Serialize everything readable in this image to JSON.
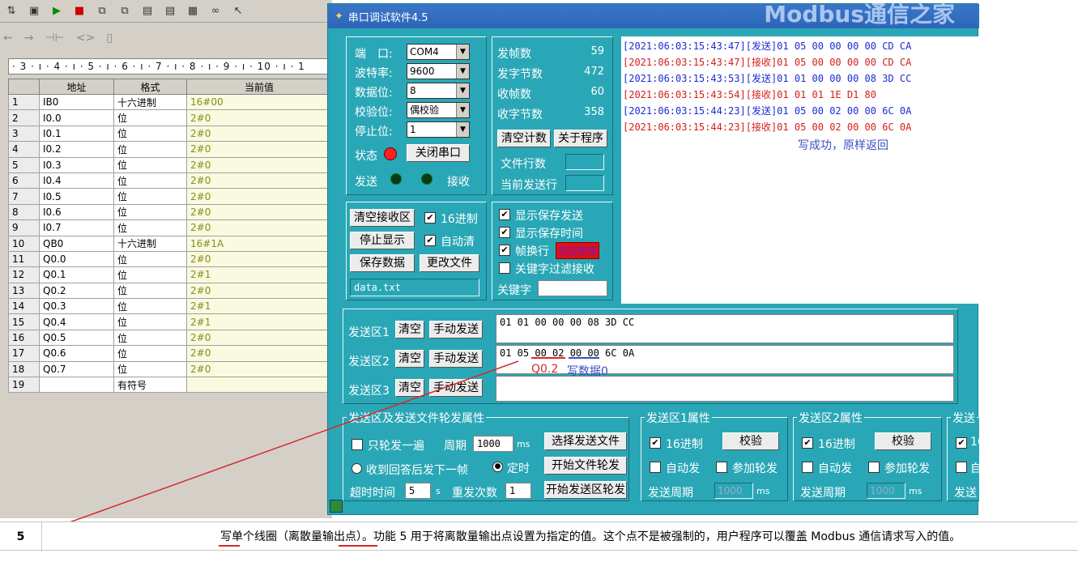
{
  "left_window": {
    "ruler": "· 3 · ı · 4 · ı · 5 · ı · 6 · ı · 7 · ı · 8 · ı · 9 · ı · 10 · ı · 1",
    "columns": [
      "地址",
      "格式",
      "当前值"
    ],
    "rows": [
      {
        "num": "1",
        "addr": "IB0",
        "fmt": "十六进制",
        "val": "16#00"
      },
      {
        "num": "2",
        "addr": "I0.0",
        "fmt": "位",
        "val": "2#0"
      },
      {
        "num": "3",
        "addr": "I0.1",
        "fmt": "位",
        "val": "2#0"
      },
      {
        "num": "4",
        "addr": "I0.2",
        "fmt": "位",
        "val": "2#0"
      },
      {
        "num": "5",
        "addr": "I0.3",
        "fmt": "位",
        "val": "2#0"
      },
      {
        "num": "6",
        "addr": "I0.4",
        "fmt": "位",
        "val": "2#0"
      },
      {
        "num": "7",
        "addr": "I0.5",
        "fmt": "位",
        "val": "2#0"
      },
      {
        "num": "8",
        "addr": "I0.6",
        "fmt": "位",
        "val": "2#0"
      },
      {
        "num": "9",
        "addr": "I0.7",
        "fmt": "位",
        "val": "2#0"
      },
      {
        "num": "10",
        "addr": "QB0",
        "fmt": "十六进制",
        "val": "16#1A"
      },
      {
        "num": "11",
        "addr": "Q0.0",
        "fmt": "位",
        "val": "2#0"
      },
      {
        "num": "12",
        "addr": "Q0.1",
        "fmt": "位",
        "val": "2#1"
      },
      {
        "num": "13",
        "addr": "Q0.2",
        "fmt": "位",
        "val": "2#0"
      },
      {
        "num": "14",
        "addr": "Q0.3",
        "fmt": "位",
        "val": "2#1"
      },
      {
        "num": "15",
        "addr": "Q0.4",
        "fmt": "位",
        "val": "2#1"
      },
      {
        "num": "16",
        "addr": "Q0.5",
        "fmt": "位",
        "val": "2#0"
      },
      {
        "num": "17",
        "addr": "Q0.6",
        "fmt": "位",
        "val": "2#0"
      },
      {
        "num": "18",
        "addr": "Q0.7",
        "fmt": "位",
        "val": "2#0"
      },
      {
        "num": "19",
        "addr": "",
        "fmt": "有符号",
        "val": ""
      }
    ]
  },
  "serial": {
    "title": "串口调试软件4.5",
    "brand": "Modbus通信之家",
    "settings": {
      "port_label": "端　口:",
      "port": "COM4",
      "baud_label": "波特率:",
      "baud": "9600",
      "databits_label": "数据位:",
      "databits": "8",
      "parity_label": "校验位:",
      "parity": "偶校验",
      "stopbits_label": "停止位:",
      "stopbits": "1",
      "status_label": "状态",
      "close_port": "关闭串口",
      "send_label": "发送",
      "recv_label": "接收"
    },
    "stats": {
      "tx_frames_label": "发帧数",
      "tx_frames": "59",
      "tx_bytes_label": "发字节数",
      "tx_bytes": "472",
      "rx_frames_label": "收帧数",
      "rx_frames": "60",
      "rx_bytes_label": "收字节数",
      "rx_bytes": "358",
      "clear_count": "清空计数",
      "about": "关于程序",
      "file_lines": "文件行数",
      "current_line": "当前发送行"
    },
    "log": [
      {
        "text": "[2021:06:03:15:43:47][发送]01 05 00 00 00 00 CD CA",
        "color": "#1b2bd8"
      },
      {
        "text": "[2021:06:03:15:43:47][接收]01 05 00 00 00 00 CD CA",
        "color": "#d81b1b"
      },
      {
        "text": "[2021:06:03:15:43:53][发送]01 01 00 00 00 08 3D CC",
        "color": "#1b2bd8"
      },
      {
        "text": "[2021:06:03:15:43:54][接收]01 01 01 1E D1 80",
        "color": "#d81b1b"
      },
      {
        "text": "[2021:06:03:15:44:23][发送]01 05 00 02 00 00 6C 0A",
        "color": "#1b2bd8"
      },
      {
        "text": "[2021:06:03:15:44:23][接收]01 05 00 02 00 00 6C 0A",
        "color": "#d81b1b"
      }
    ],
    "log_note": "写成功，原样返回",
    "recv_controls": {
      "clear_recv": "清空接收区",
      "hex16": "16进制",
      "stop_display": "停止显示",
      "auto_clear": "自动清",
      "save_data": "保存数据",
      "change_file": "更改文件",
      "filename": "data.txt"
    },
    "display_opts": {
      "show_saved_send": "显示保存发送",
      "show_saved_time": "显示保存时间",
      "frame_newline": "帧换行",
      "welcome": "欢迎使用",
      "keyword_filter": "关键字过滤接收",
      "keyword_label": "关键字"
    },
    "send_areas": [
      {
        "label": "发送区1",
        "clear": "清空",
        "manual": "手动发送",
        "data": "01 01 00 00 00 08 3D CC"
      },
      {
        "label": "发送区2",
        "clear": "清空",
        "manual": "手动发送",
        "data": "01 05 00 02 00 00 6C 0A"
      },
      {
        "label": "发送区3",
        "clear": "清空",
        "manual": "手动发送",
        "data": ""
      }
    ],
    "annotations": {
      "q02": "Q0.2",
      "write0": "写数据0"
    },
    "poll": {
      "title": "发送区及发送文件轮发属性",
      "once": "只轮发一遍",
      "period_label": "周期",
      "period": "1000",
      "period_unit": "ms",
      "select_file": "选择发送文件",
      "after_reply": "收到回答后发下一帧",
      "timed": "定时",
      "start_file": "开始文件轮发",
      "timeout_label": "超时时间",
      "timeout": "5",
      "timeout_unit": "s",
      "retry_label": "重发次数",
      "retry": "1",
      "start_area": "开始发送区轮发"
    },
    "area1_props": {
      "title": "发送区1属性",
      "hex": "16进制",
      "verify": "校验",
      "auto": "自动发",
      "poll": "参加轮发",
      "period_label": "发送周期",
      "period": "1000",
      "unit": "ms"
    },
    "area2_props": {
      "title": "发送区2属性",
      "hex": "16进制",
      "verify": "校验",
      "auto": "自动发",
      "poll": "参加轮发",
      "period_label": "发送周期",
      "period": "1000",
      "unit": "ms"
    },
    "area3_props": {
      "title": "发送",
      "hex": "16",
      "auto": "自",
      "period_label": "发送"
    }
  },
  "doc": {
    "number": "5",
    "text": "写单个线圈（离散量输出点）。功能 5 用于将离散量输出点设置为指定的值。这个点不是被强制的，用户程序可以覆盖 Modbus 通信请求写入的值。"
  },
  "colors": {
    "teal": "#2aa7b6",
    "annotation_red": "#d42a2a",
    "annotation_blue": "#3a4fc8"
  }
}
